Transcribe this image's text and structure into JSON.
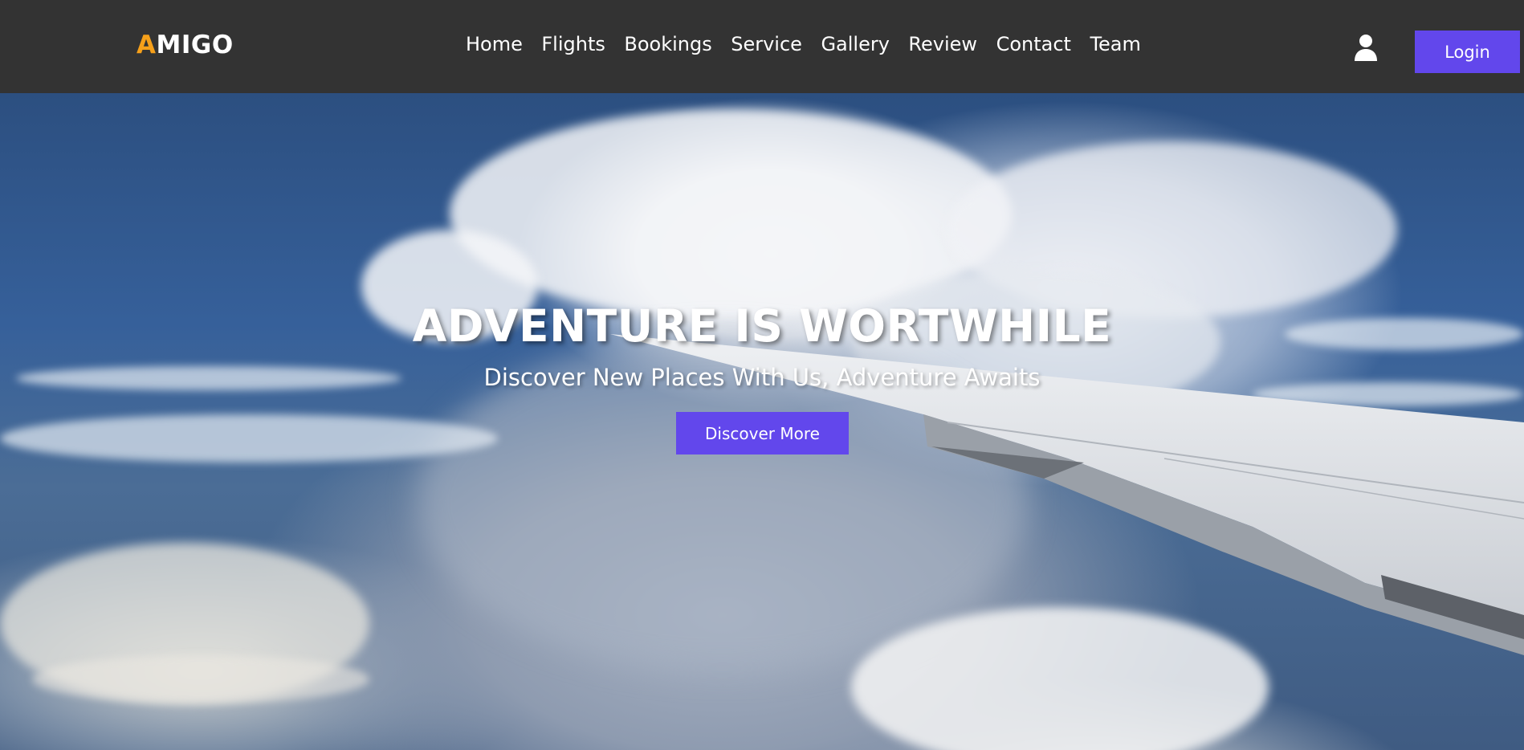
{
  "brand": {
    "logo_first": "A",
    "logo_rest": "MIGO",
    "accent_color": "#f6a01a"
  },
  "nav": {
    "items": [
      "Home",
      "Flights",
      "Bookings",
      "Service",
      "Gallery",
      "Review",
      "Contact",
      "Team"
    ]
  },
  "header": {
    "user_icon": "user-icon",
    "login_label": "Login",
    "button_color": "#6247ec"
  },
  "hero": {
    "title": "ADVENTURE IS WORTWHILE",
    "subtitle": "Discover New Places With Us, Adventure Awaits",
    "cta_label": "Discover More"
  }
}
